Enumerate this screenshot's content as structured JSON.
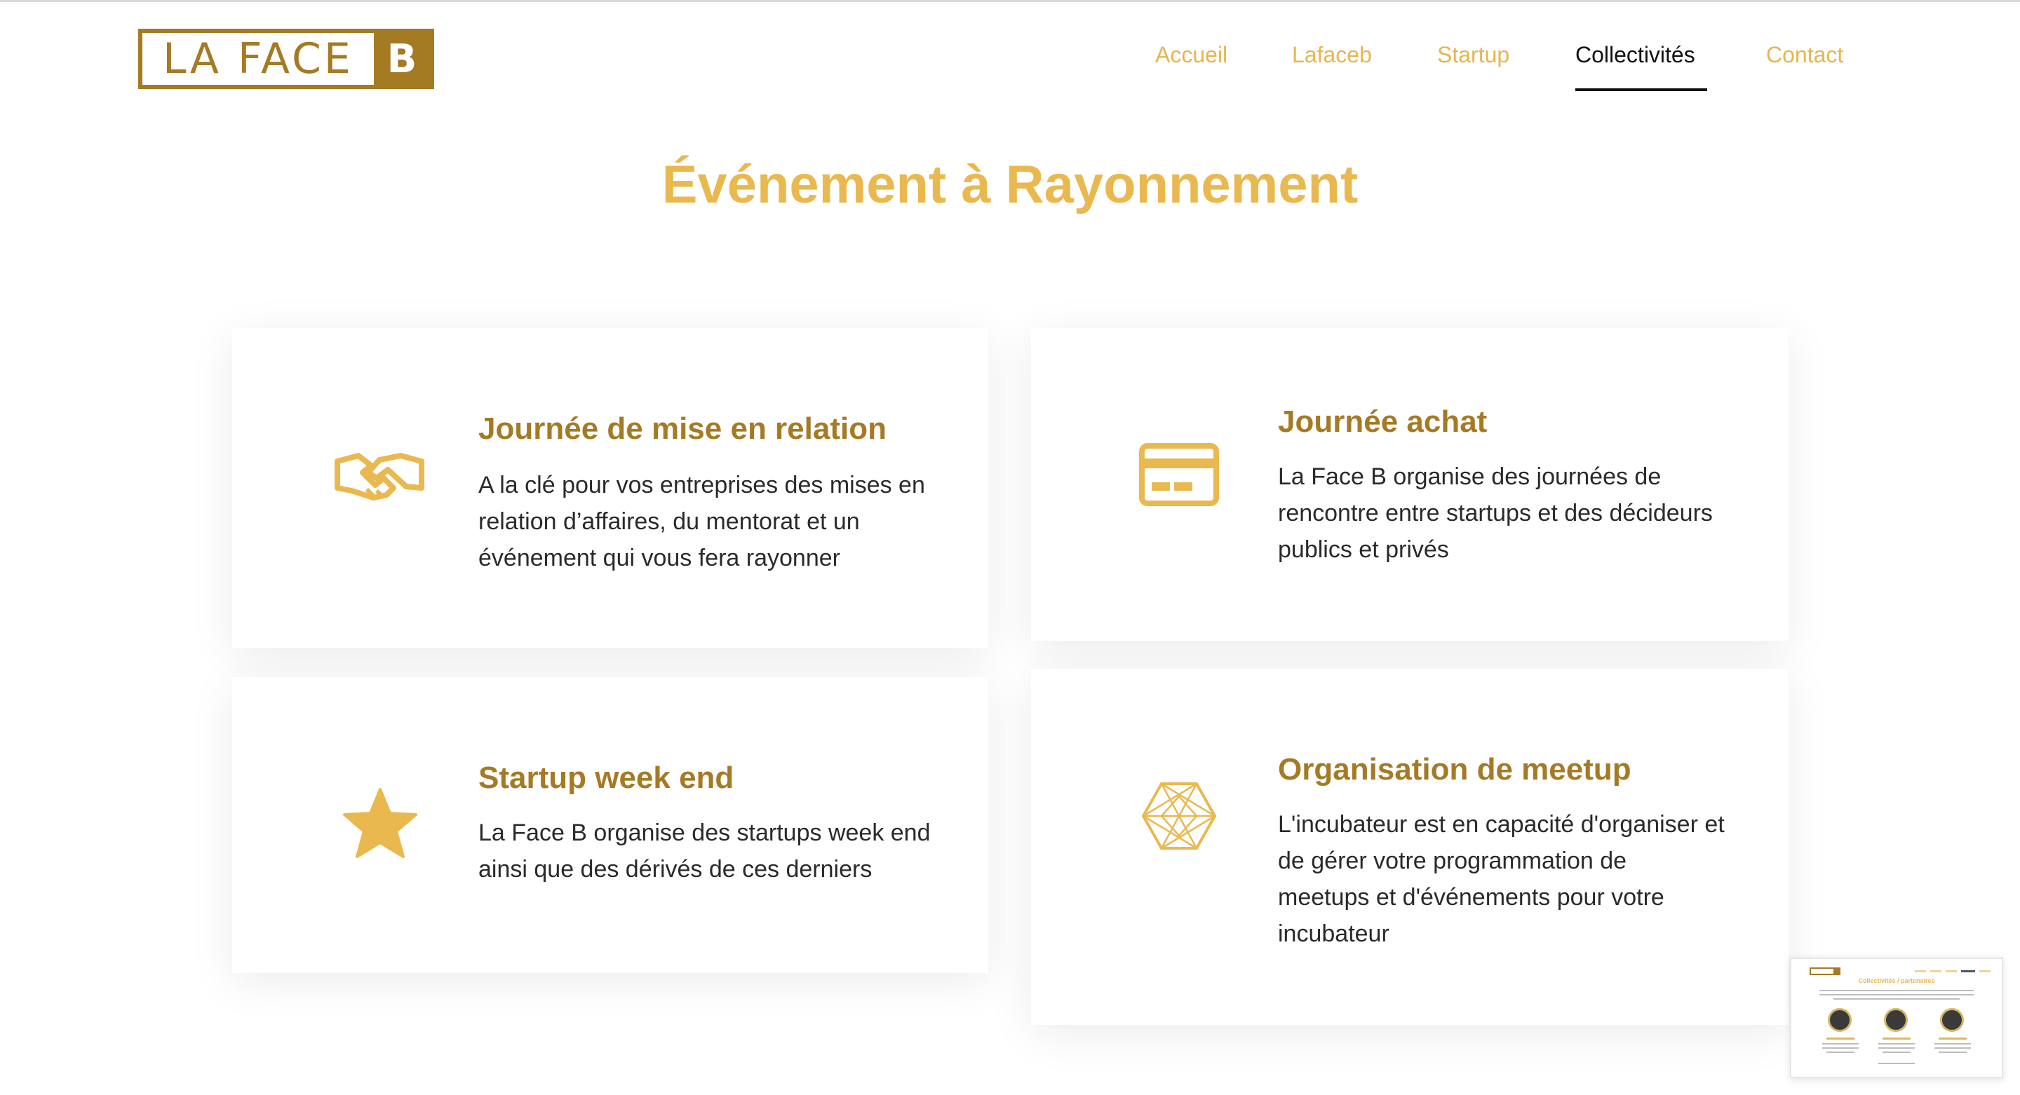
{
  "header": {
    "logo": {
      "left": "LA FACE",
      "right": "B"
    },
    "nav": [
      {
        "label": "Accueil",
        "active": false
      },
      {
        "label": "Lafaceb",
        "active": false
      },
      {
        "label": "Startup",
        "active": false
      },
      {
        "label": "Collectivités",
        "active": true
      },
      {
        "label": "Contact",
        "active": false
      }
    ]
  },
  "main": {
    "title": "Événement à Rayonnement",
    "cards": [
      {
        "icon": "handshake-icon",
        "title": "Journée de mise en relation",
        "lines": [
          "A la clé pour vos entreprises des mises en",
          "relation d’affaires, du mentorat et un",
          "événement qui vous fera rayonner"
        ]
      },
      {
        "icon": "credit-card-icon",
        "title": "Journée achat",
        "lines": [
          "La Face B organise des journées de",
          "rencontre entre startups et des décideurs",
          "publics et privés"
        ]
      },
      {
        "icon": "star-icon",
        "title": "Startup week end",
        "lines": [
          "La Face B organise des startups week end",
          "ainsi que des dérivés de ces derniers"
        ]
      },
      {
        "icon": "network-polygon-icon",
        "title": "Organisation de meetup",
        "lines": [
          "L'incubateur est en capacité d'organiser et",
          "de gérer votre programmation de",
          "meetups et d'événements pour votre",
          "incubateur"
        ]
      }
    ]
  },
  "thumbnail": {
    "title": "Collectivités / partenaires"
  },
  "colors": {
    "accent_gold": "#e9b84f",
    "brand_dark_gold": "#a47a23",
    "card_title": "#a57a24",
    "text": "#2a2a2a"
  }
}
